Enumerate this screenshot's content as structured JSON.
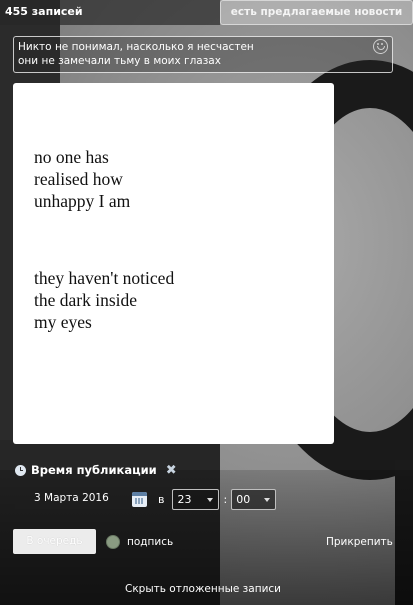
{
  "header": {
    "records_count": "455 записей",
    "suggested_news": "есть предлагаемые новости"
  },
  "post": {
    "text_line1": "Никто не понимал, насколько я несчастен",
    "text_line2": "они не замечали тьму в моих глазах",
    "emoji_icon": "smile-icon"
  },
  "image": {
    "quote_part1": "no one has\nrealised how\nunhappy I am",
    "quote_part2": "they haven't noticed\nthe dark inside\nmy eyes"
  },
  "schedule": {
    "title": "Время публикации",
    "date": "3 Марта 2016",
    "at_label": "в",
    "hour": "23",
    "separator": ":",
    "minute": "00"
  },
  "actions": {
    "queue_label": "В очередь",
    "sign_label": "подпись",
    "attach_label": "Прикрепить",
    "hide_label": "Скрыть отложенные записи"
  },
  "colors": {
    "card_bg": "#ffffff",
    "toggle_green": "#8a9b82",
    "button_bg": "#ececec"
  }
}
